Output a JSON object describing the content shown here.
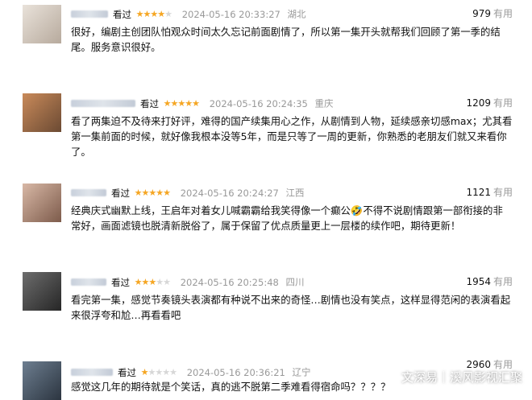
{
  "reviews": [
    {
      "seen_label": "看过",
      "stars": 4,
      "time": "2024-05-16 20:33:27",
      "location": "湖北",
      "useful_count": "979",
      "useful_label": "有用",
      "text": "很好，编剧主创团队怕观众时间太久忘记前面剧情了，所以第一集开头就帮我们回顾了第一季的结尾。服务意识很好。"
    },
    {
      "seen_label": "看过",
      "stars": 5,
      "time": "2024-05-16 20:24:35",
      "location": "重庆",
      "useful_count": "1209",
      "useful_label": "有用",
      "text": "看了两集迫不及待来打好评，难得的国产续集用心之作，从剧情到人物，延续感亲切感max；尤其看第一集前面的时候，就好像我根本没等5年，而是只等了一周的更新，你熟悉的老朋友们就又来看你了。"
    },
    {
      "seen_label": "看过",
      "stars": 5,
      "time": "2024-05-16 20:24:27",
      "location": "江西",
      "useful_count": "1121",
      "useful_label": "有用",
      "text": "经典庆式幽默上线，王启年对着女儿喊霸霸给我笑得像一个癫公🤣不得不说剧情跟第一部衔接的非常好，画面滤镜也脱清新脱俗了，属于保留了优点质量更上一层楼的续作吧，期待更新！"
    },
    {
      "seen_label": "看过",
      "stars": 3,
      "time": "2024-05-16 20:25:48",
      "location": "四川",
      "useful_count": "1954",
      "useful_label": "有用",
      "text": "看完第一集，感觉节奏镜头表演都有种说不出来的奇怪…剧情也没有笑点，这样显得范闲的表演看起来很浮夸和尬…再看看吧"
    },
    {
      "seen_label": "看过",
      "stars": 1,
      "time": "2024-05-16 20:36:21",
      "location": "辽宁",
      "useful_count": "2960",
      "useful_label": "有用",
      "text": "感觉这几年的期待就是个笑话，真的逃不脱第二季难看得宿命吗？？？？"
    }
  ],
  "watermark": "文深易｜溪风影视汇聚",
  "colors": {
    "star": "#f5a623",
    "star_off": "#d7d7d7",
    "muted": "#999999"
  }
}
